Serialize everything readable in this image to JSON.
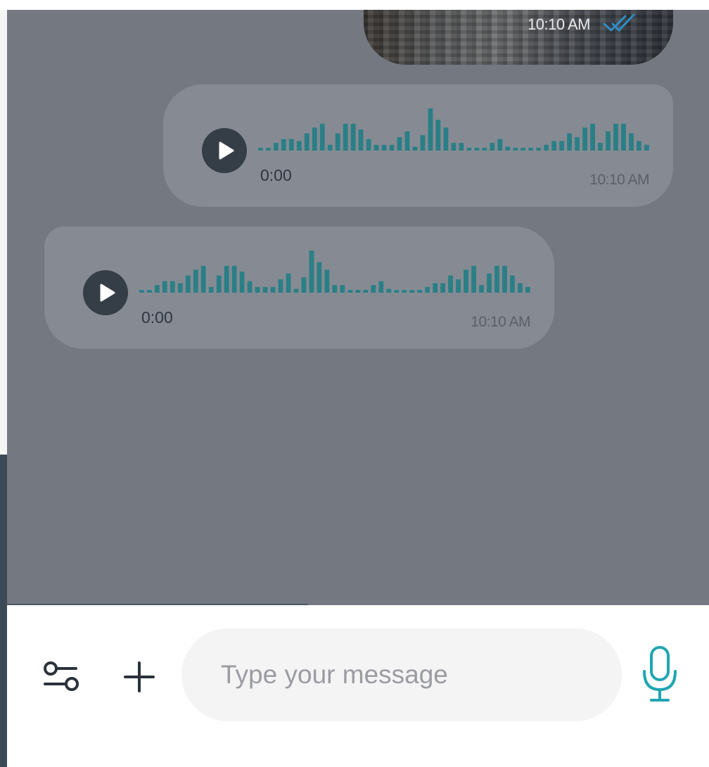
{
  "colors": {
    "accent": "#1fa6b2",
    "waveform": "#2a7f86",
    "chat_overlay": "#737881",
    "bubble": "#868b93",
    "play_button": "#353d47"
  },
  "icons": {
    "settings": "sliders-icon",
    "add": "plus-icon",
    "voice": "microphone-icon",
    "play": "play-icon",
    "read_receipt": "double-check-icon"
  },
  "messages": {
    "image": {
      "time": "10:10 AM"
    },
    "voice_outgoing": {
      "duration": "0:00",
      "time": "10:10 AM"
    },
    "voice_incoming": {
      "duration": "0:00",
      "time": "10:10 AM"
    }
  },
  "composer": {
    "placeholder": "Type your message",
    "value": ""
  }
}
